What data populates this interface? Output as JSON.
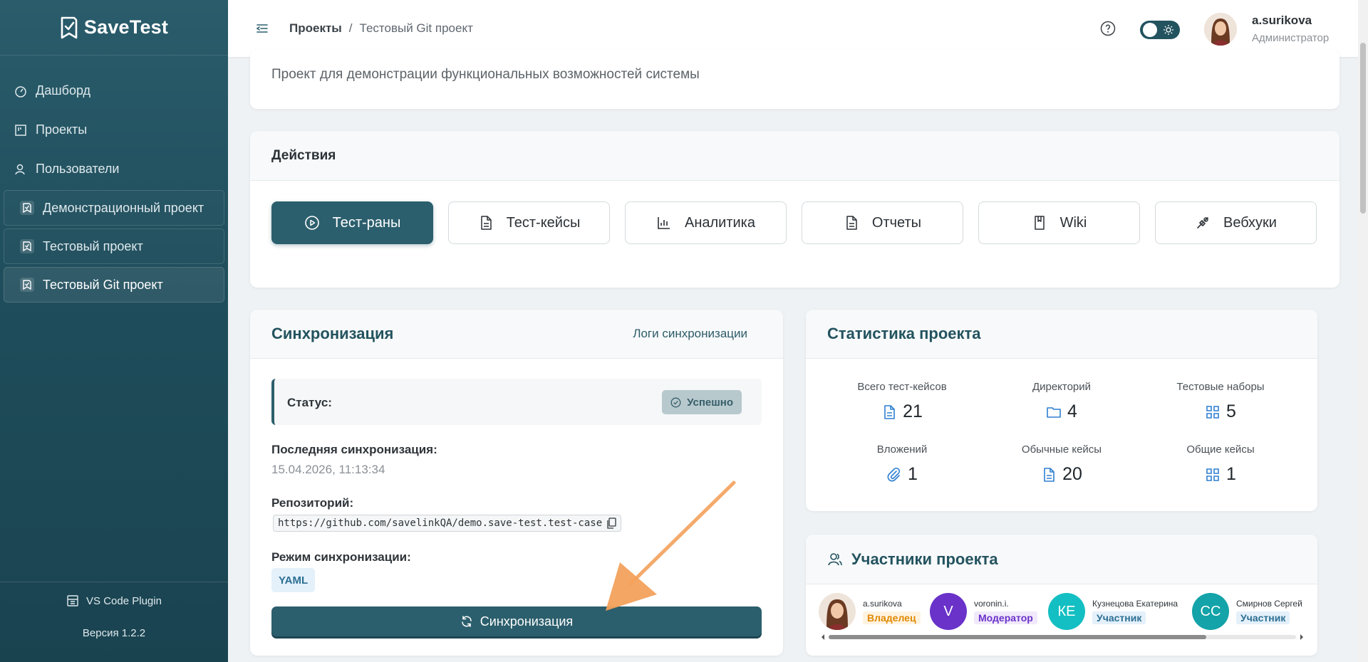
{
  "app": {
    "name": "SaveTest"
  },
  "sidebar": {
    "nav": [
      {
        "label": "Дашборд",
        "icon": "dashboard-icon"
      },
      {
        "label": "Проекты",
        "icon": "projects-icon"
      },
      {
        "label": "Пользователи",
        "icon": "users-icon"
      }
    ],
    "projects": [
      {
        "label": "Демонстрационный проект",
        "active": false
      },
      {
        "label": "Тестовый проект",
        "active": false
      },
      {
        "label": "Тестовый Git проект",
        "active": true
      }
    ],
    "plugin_label": "VS Code Plugin",
    "version": "Версия 1.2.2"
  },
  "header": {
    "breadcrumb": [
      "Проекты",
      "/",
      "Тестовый Git проект"
    ],
    "user": {
      "name": "a.surikova",
      "role": "Администратор"
    }
  },
  "description": "Проект для демонстрации функциональных возможностей системы",
  "actions": {
    "title": "Действия",
    "buttons": [
      {
        "label": "Тест-раны",
        "icon": "play-icon",
        "primary": true
      },
      {
        "label": "Тест-кейсы",
        "icon": "document-icon"
      },
      {
        "label": "Аналитика",
        "icon": "bar-chart-icon"
      },
      {
        "label": "Отчеты",
        "icon": "report-icon"
      },
      {
        "label": "Wiki",
        "icon": "book-icon"
      },
      {
        "label": "Вебхуки",
        "icon": "webhook-icon"
      }
    ]
  },
  "sync": {
    "title": "Синхронизация",
    "logs_link": "Логи синхронизации",
    "status_label": "Статус:",
    "status_value": "Успешно",
    "last_sync_label": "Последняя синхронизация:",
    "last_sync_value": "15.04.2026, 11:13:34",
    "repo_label": "Репозиторий:",
    "repo_value": "https://github.com/savelinkQA/demo.save-test.test-case",
    "mode_label": "Режим синхронизации:",
    "mode_value": "YAML",
    "button": "Синхронизация"
  },
  "stats": {
    "title": "Статистика проекта",
    "items": [
      {
        "label": "Всего тест-кейсов",
        "value": "21",
        "icon": "document-icon"
      },
      {
        "label": "Директорий",
        "value": "4",
        "icon": "folder-icon"
      },
      {
        "label": "Тестовые наборы",
        "value": "5",
        "icon": "grid-icon"
      },
      {
        "label": "Вложений",
        "value": "1",
        "icon": "paperclip-icon"
      },
      {
        "label": "Обычные кейсы",
        "value": "20",
        "icon": "document-icon"
      },
      {
        "label": "Общие кейсы",
        "value": "1",
        "icon": "grid-icon"
      }
    ]
  },
  "members": {
    "title": "Участники проекта",
    "list": [
      {
        "name": "a.surikova",
        "initials": "",
        "role": "Владелец",
        "avatar_color": "#e9dfd6",
        "role_bg": "#fff3e0",
        "role_color": "#e08a00"
      },
      {
        "name": "voronin.i.",
        "initials": "V",
        "role": "Модератор",
        "avatar_color": "#6a32c9",
        "role_bg": "#f1e9fb",
        "role_color": "#6a32c9"
      },
      {
        "name": "Кузнецова Екатерина",
        "initials": "КЕ",
        "role": "Участник",
        "avatar_color": "#13bfc2",
        "role_bg": "#e4f0fa",
        "role_color": "#2c6f93"
      },
      {
        "name": "Смирнов Сергей",
        "initials": "СС",
        "role": "Участник",
        "avatar_color": "#13a3a8",
        "role_bg": "#e4f0fa",
        "role_color": "#2c6f93"
      }
    ]
  },
  "colors": {
    "primary": "#2c5f6d",
    "sidebar": "#1f4d5b",
    "accent_blue": "#2f7fd1",
    "annotation_arrow": "#f3a15c"
  }
}
